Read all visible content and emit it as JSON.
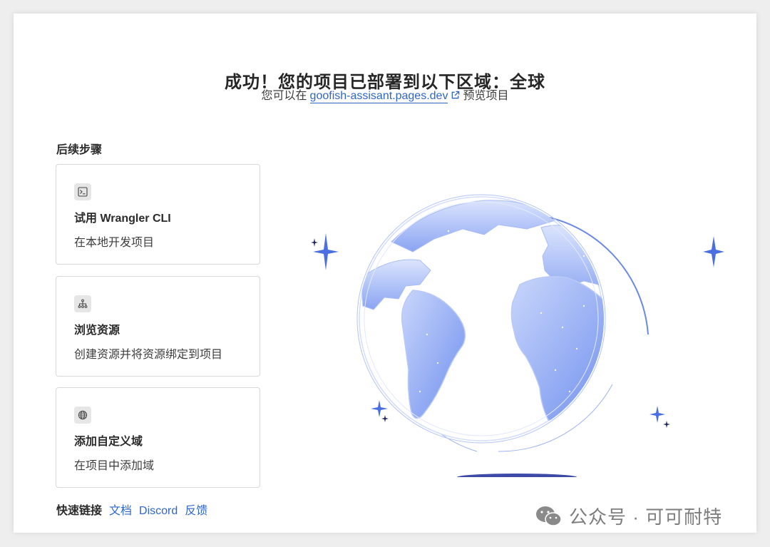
{
  "header": {
    "title": "成功！您的项目已部署到以下区域：全球",
    "subtitle_prefix": "您可以在",
    "preview_url": "goofish-assisant.pages.dev",
    "subtitle_suffix": "预览项目"
  },
  "next_steps": {
    "label": "后续步骤",
    "cards": [
      {
        "icon": "terminal-icon",
        "title": "试用 Wrangler CLI",
        "description": "在本地开发项目"
      },
      {
        "icon": "hierarchy-icon",
        "title": "浏览资源",
        "description": "创建资源并将资源绑定到项目"
      },
      {
        "icon": "globe-icon",
        "title": "添加自定义域",
        "description": "在项目中添加域"
      }
    ]
  },
  "quick_links": {
    "label": "快速链接",
    "items": [
      "文档",
      "Discord",
      "反馈"
    ]
  },
  "watermark": {
    "text": "公众号 · 可可耐特"
  },
  "colors": {
    "link": "#2f66c8",
    "globe_fill": "#8fa9f2",
    "sparkle": "#4a6fe0",
    "shadow": "#3d4aa8"
  }
}
